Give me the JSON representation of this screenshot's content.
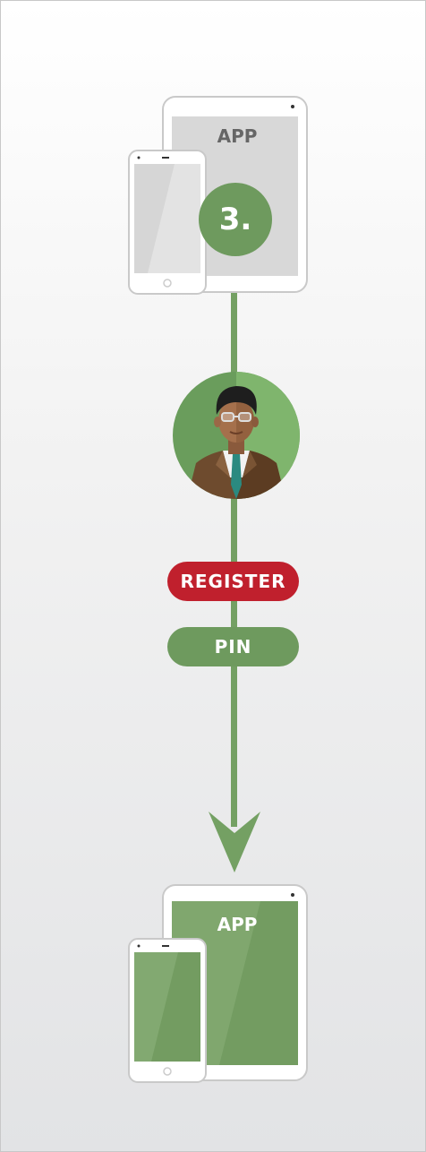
{
  "step": {
    "number": "3."
  },
  "top_device": {
    "label": "APP",
    "state": "inactive",
    "color": "#d8d8d8"
  },
  "actions": [
    {
      "label": "REGISTER",
      "color": "#c0202d"
    },
    {
      "label": "PIN",
      "color": "#6e9a5e"
    }
  ],
  "bottom_device": {
    "label": "APP",
    "state": "active",
    "color": "#739c61"
  },
  "colors": {
    "accent_green": "#6e9a5e",
    "flow_line": "#74a063",
    "register_red": "#c0202d"
  },
  "icons": [
    "tablet-icon",
    "phone-icon",
    "person-avatar-icon",
    "arrow-down-icon"
  ]
}
